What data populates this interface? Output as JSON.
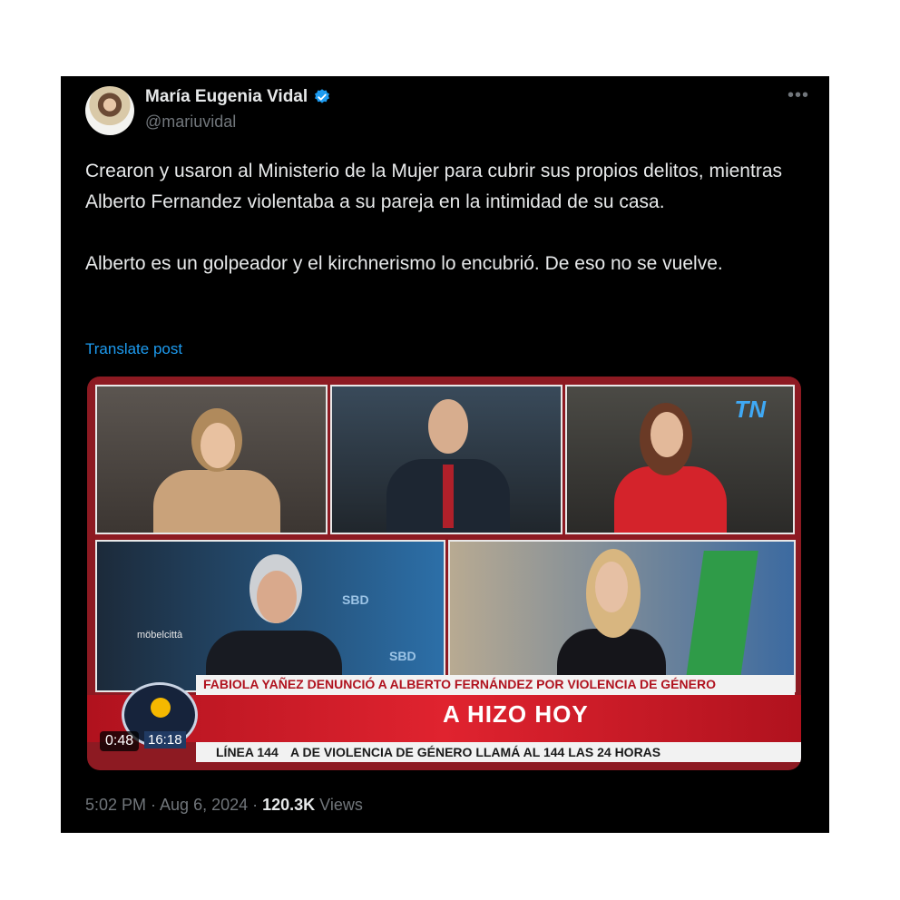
{
  "author": {
    "name": "María Eugenia Vidal",
    "handle": "@mariuvidal",
    "verified_color": "#1d9bf0"
  },
  "post": {
    "text": "Crearon y usaron al Ministerio de la Mujer para cubrir sus propios delitos, mientras Alberto Fernandez violentaba a su pareja en la intimidad de su casa.\n\nAlberto es un golpeador y el kirchnerismo lo encubrió. De eso no se vuelve.",
    "translate_label": "Translate post"
  },
  "video": {
    "duration": "0:48",
    "tn_logo": "TN",
    "headline": "FABIOLA YAÑEZ DENUNCIÓ A ALBERTO FERNÁNDEZ POR VIOLENCIA DE GÉNERO",
    "big_title": "A HIZO HOY",
    "ticker_label": "LÍNEA 144",
    "ticker_text": "A DE VIOLENCIA DE GÉNERO LLAMÁ AL 144 LAS 24 HORAS",
    "clock": "16:18",
    "screen_label": "möbelcittà",
    "sbd_label": "SBD"
  },
  "meta": {
    "time_date": "5:02 PM · Aug 6, 2024 · ",
    "views_count": "120.3K",
    "views_label": " Views"
  }
}
